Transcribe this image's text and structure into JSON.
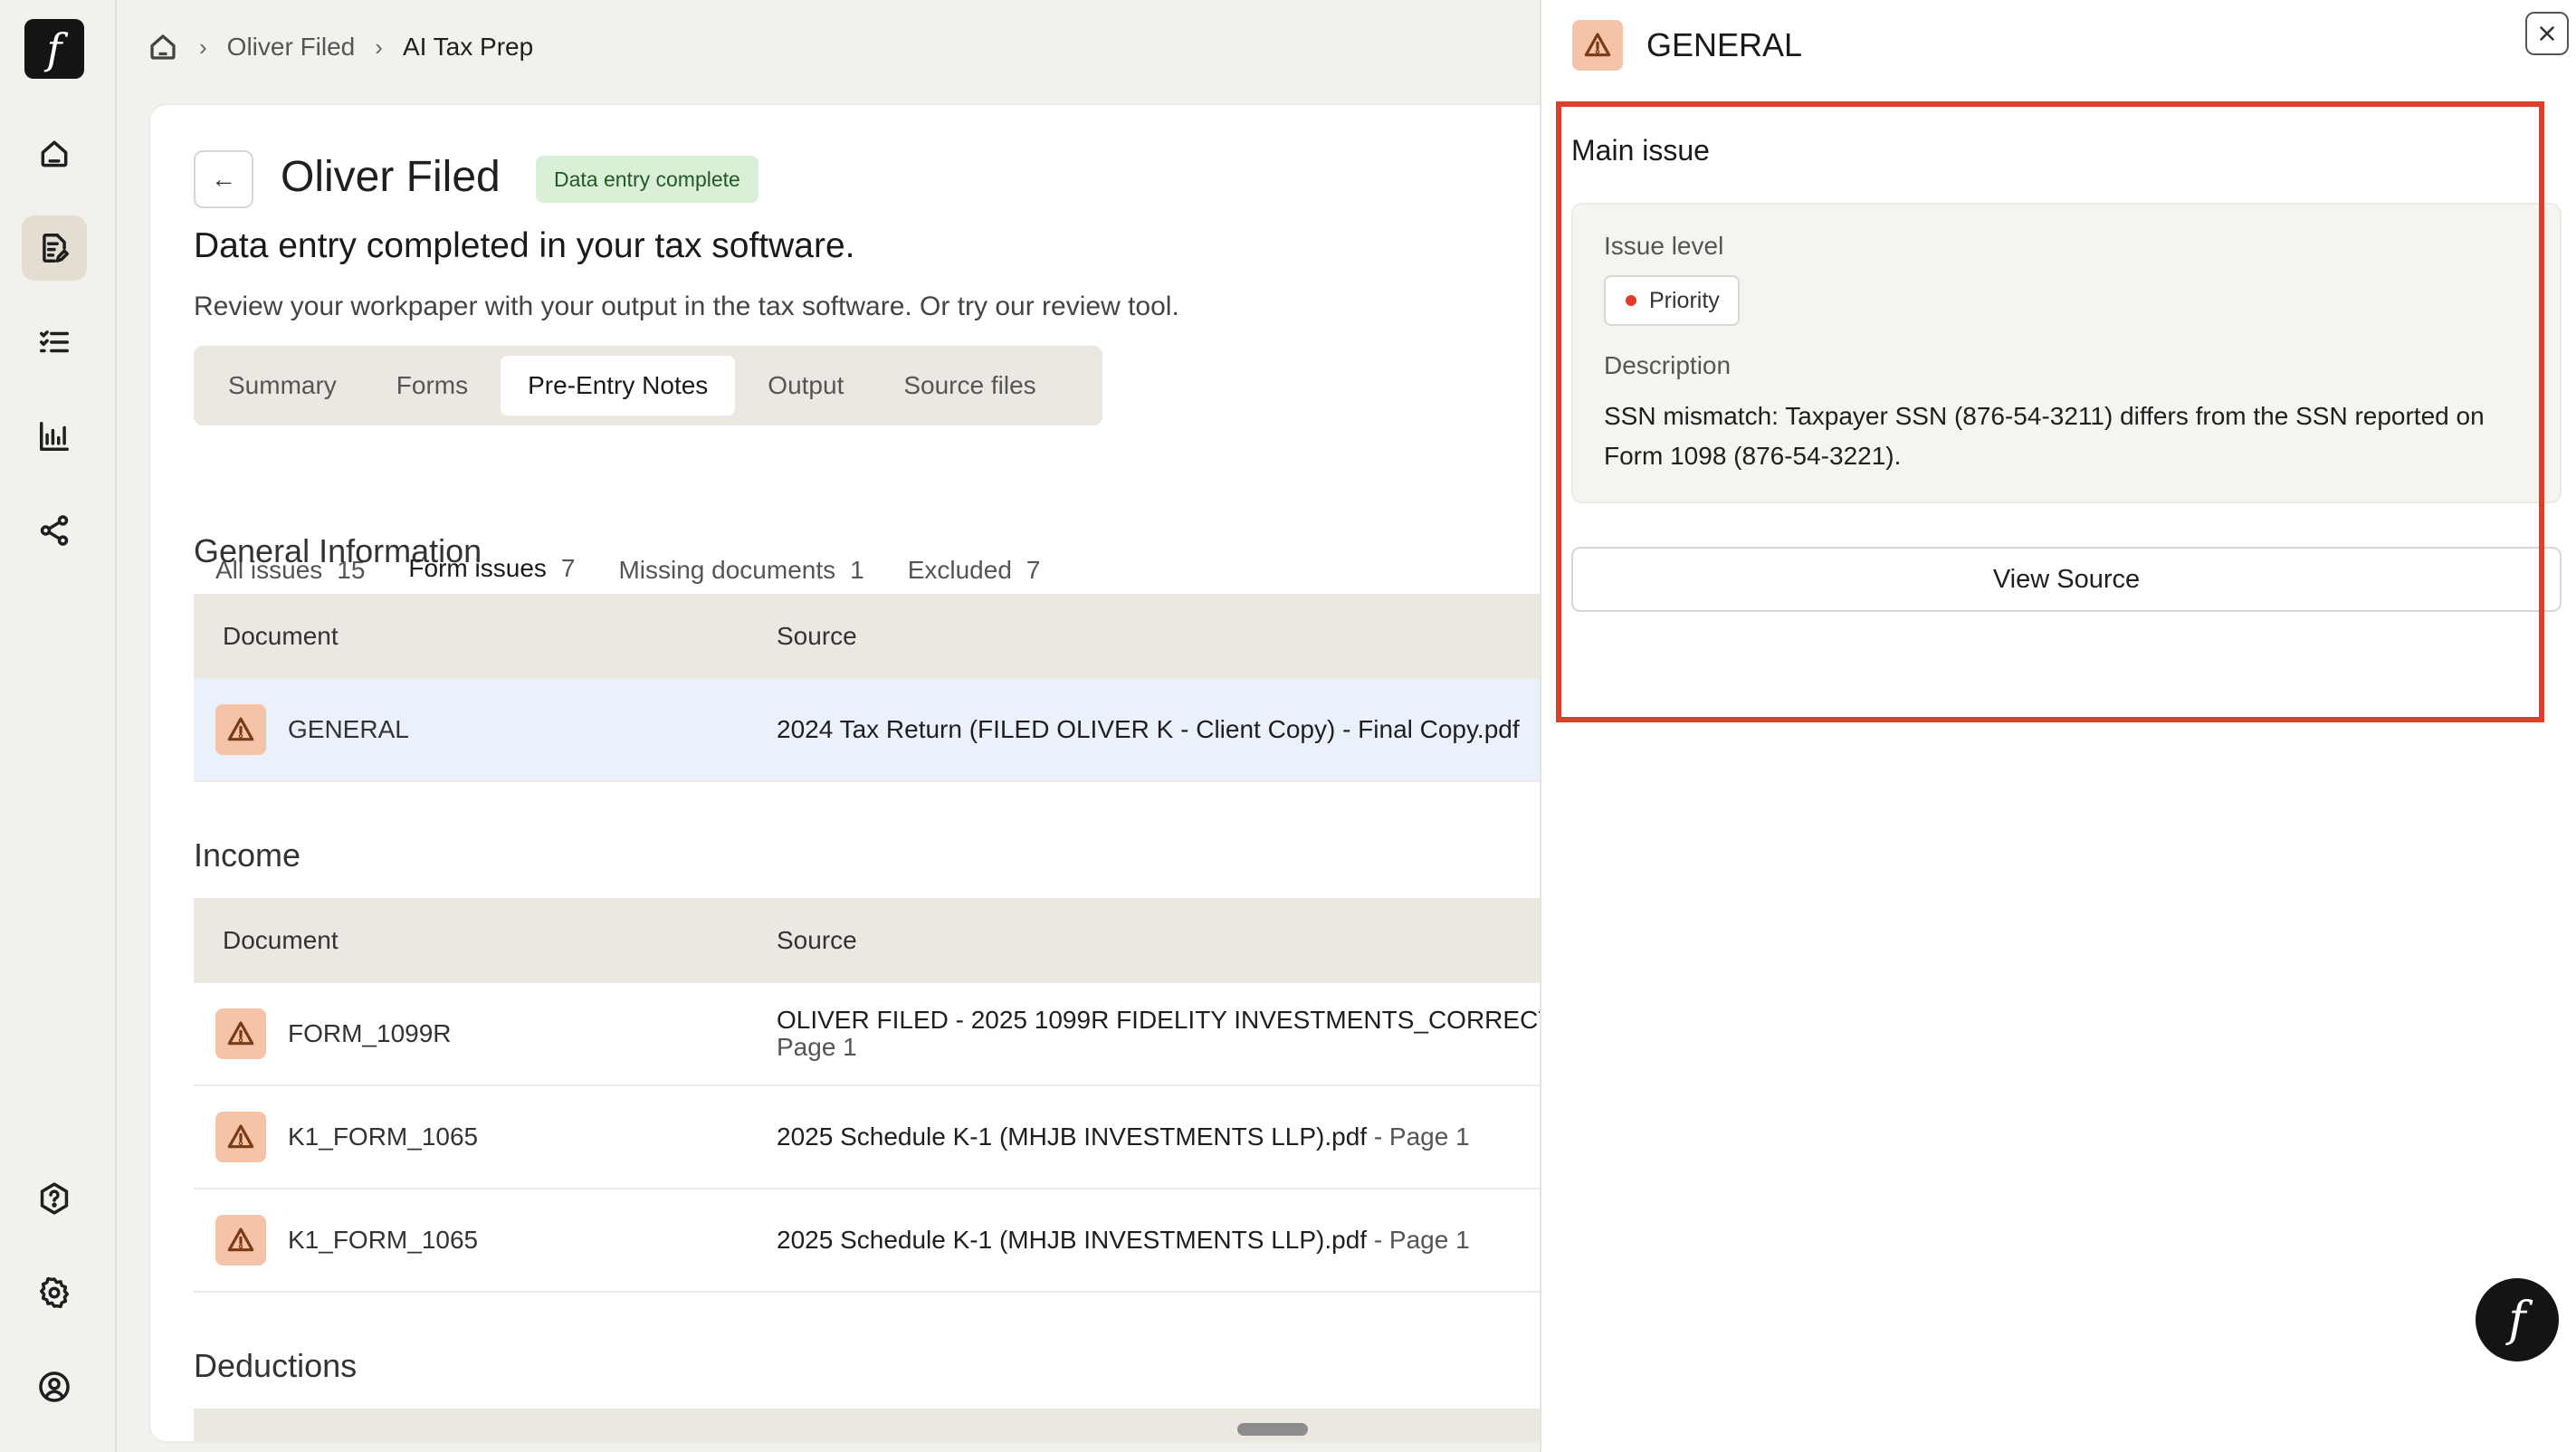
{
  "app": {
    "logo_glyph": "f"
  },
  "breadcrumb": {
    "items": [
      "Oliver Filed",
      "AI Tax Prep"
    ]
  },
  "client": {
    "name": "Oliver Filed",
    "status": "Data entry complete",
    "heading": "Data entry completed in your tax software.",
    "subheading": "Review your workpaper with your output in the tax software. Or try our review tool."
  },
  "tabs": [
    "Summary",
    "Forms",
    "Pre-Entry Notes",
    "Output",
    "Source files"
  ],
  "active_tab": "Pre-Entry Notes",
  "subtabs": [
    {
      "label": "All issues",
      "count": "15"
    },
    {
      "label": "Form issues",
      "count": "7"
    },
    {
      "label": "Missing documents",
      "count": "1"
    },
    {
      "label": "Excluded",
      "count": "7"
    }
  ],
  "columns": {
    "document": "Document",
    "source": "Source"
  },
  "sections": {
    "general": {
      "title": "General Information",
      "rows": [
        {
          "document": "GENERAL",
          "source": "2024 Tax Return (FILED OLIVER K - Client Copy) - Final Copy.pdf",
          "page": ""
        }
      ]
    },
    "income": {
      "title": "Income",
      "rows": [
        {
          "document": "FORM_1099R",
          "source": "OLIVER FILED - 2025 1099R FIDELITY INVESTMENTS_CORRECT",
          "page": "Page 1"
        },
        {
          "document": "K1_FORM_1065",
          "source": "2025 Schedule K-1 (MHJB INVESTMENTS LLP).pdf",
          "page": " - Page 1"
        },
        {
          "document": "K1_FORM_1065",
          "source": "2025 Schedule K-1 (MHJB INVESTMENTS LLP).pdf",
          "page": " - Page 1"
        }
      ]
    },
    "deductions": {
      "title": "Deductions"
    }
  },
  "panel": {
    "title": "GENERAL",
    "main_issue_label": "Main issue",
    "issue_level_label": "Issue level",
    "issue_level": "Priority",
    "description_label": "Description",
    "description": "SSN mismatch: Taxpayer SSN (876-54-3211) differs from the SSN reported on Form 1098 (876-54-3221).",
    "view_source": "View Source"
  },
  "icons": {
    "rail": [
      "home-icon",
      "document-edit-icon",
      "checklist-icon",
      "chart-icon",
      "share-icon",
      "help-icon",
      "gear-icon",
      "user-icon"
    ],
    "warning": "warning-triangle-icon"
  },
  "colors": {
    "accent_red": "#e03c2a",
    "warning_bg": "#f5c4a8",
    "status_badge_bg": "#d9efd8",
    "highlight_row": "#eaf1fb"
  }
}
